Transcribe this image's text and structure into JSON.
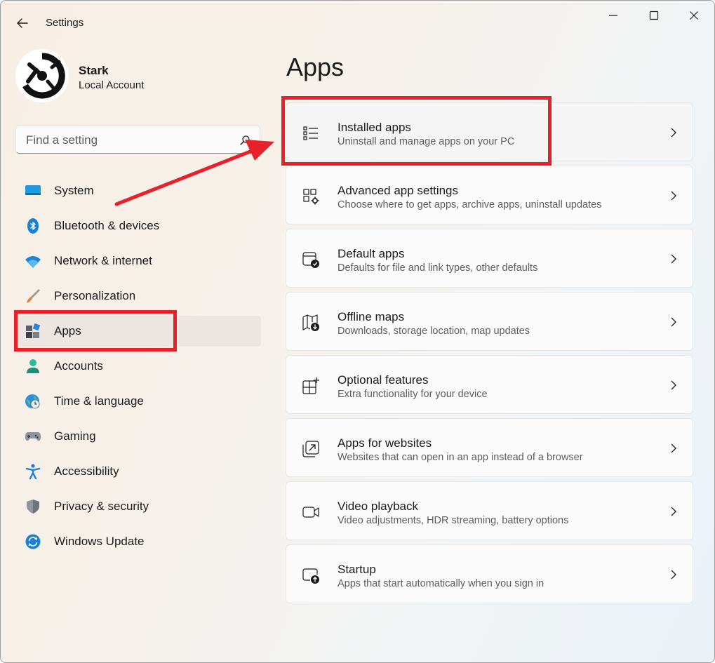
{
  "window": {
    "title": "Settings",
    "controls": [
      "minimize",
      "maximize",
      "close"
    ]
  },
  "profile": {
    "name": "Stark",
    "account_type": "Local Account"
  },
  "search": {
    "placeholder": "Find a setting"
  },
  "sidebar": {
    "selected": "Apps",
    "items": [
      {
        "label": "System",
        "icon": "system-icon"
      },
      {
        "label": "Bluetooth & devices",
        "icon": "bluetooth-icon"
      },
      {
        "label": "Network & internet",
        "icon": "wifi-icon"
      },
      {
        "label": "Personalization",
        "icon": "brush-icon"
      },
      {
        "label": "Apps",
        "icon": "apps-icon"
      },
      {
        "label": "Accounts",
        "icon": "person-icon"
      },
      {
        "label": "Time & language",
        "icon": "globe-clock-icon"
      },
      {
        "label": "Gaming",
        "icon": "gamepad-icon"
      },
      {
        "label": "Accessibility",
        "icon": "accessibility-icon"
      },
      {
        "label": "Privacy & security",
        "icon": "shield-icon"
      },
      {
        "label": "Windows Update",
        "icon": "update-icon"
      }
    ]
  },
  "main": {
    "title": "Apps",
    "cards": [
      {
        "title": "Installed apps",
        "subtitle": "Uninstall and manage apps on your PC",
        "icon": "list-icon"
      },
      {
        "title": "Advanced app settings",
        "subtitle": "Choose where to get apps, archive apps, uninstall updates",
        "icon": "app-settings-icon"
      },
      {
        "title": "Default apps",
        "subtitle": "Defaults for file and link types, other defaults",
        "icon": "default-apps-icon"
      },
      {
        "title": "Offline maps",
        "subtitle": "Downloads, storage location, map updates",
        "icon": "map-download-icon"
      },
      {
        "title": "Optional features",
        "subtitle": "Extra functionality for your device",
        "icon": "add-feature-icon"
      },
      {
        "title": "Apps for websites",
        "subtitle": "Websites that can open in an app instead of a browser",
        "icon": "open-in-app-icon"
      },
      {
        "title": "Video playback",
        "subtitle": "Video adjustments, HDR streaming, battery options",
        "icon": "video-icon"
      },
      {
        "title": "Startup",
        "subtitle": "Apps that start automatically when you sign in",
        "icon": "startup-icon"
      }
    ]
  },
  "colors": {
    "annotation": "#e8202a",
    "accent_blue": "#0067c0",
    "selected_nav_bg": "#ebe6e1"
  }
}
